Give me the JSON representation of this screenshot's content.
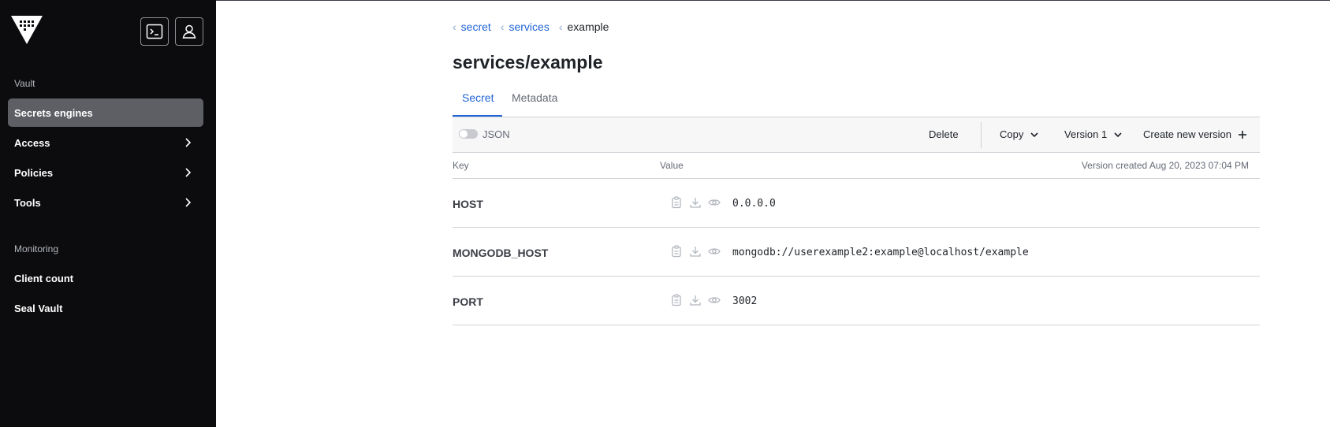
{
  "sidebar": {
    "sections": [
      {
        "label": "Vault"
      },
      {
        "label": "Monitoring"
      }
    ],
    "items": [
      {
        "label": "Secrets engines"
      },
      {
        "label": "Access"
      },
      {
        "label": "Policies"
      },
      {
        "label": "Tools"
      },
      {
        "label": "Client count"
      },
      {
        "label": "Seal Vault"
      }
    ]
  },
  "breadcrumb": [
    {
      "label": "secret"
    },
    {
      "label": "services"
    },
    {
      "label": "example"
    }
  ],
  "page": {
    "title": "services/example"
  },
  "tabs": [
    {
      "label": "Secret"
    },
    {
      "label": "Metadata"
    }
  ],
  "toolbar": {
    "json_label": "JSON",
    "delete_label": "Delete",
    "copy_label": "Copy",
    "version_label": "Version 1",
    "create_label": "Create new version"
  },
  "table": {
    "headers": {
      "key": "Key",
      "value": "Value"
    },
    "version_created": "Version created Aug 20, 2023 07:04 PM",
    "rows": [
      {
        "key": "HOST",
        "value": "0.0.0.0"
      },
      {
        "key": "MONGODB_HOST",
        "value": "mongodb://userexample2:example@localhost/example"
      },
      {
        "key": "PORT",
        "value": "3002"
      }
    ]
  },
  "colors": {
    "sidebar_bg": "#0c0c0e",
    "active_item_bg": "#5d5f65",
    "link_blue": "#2264d6"
  }
}
